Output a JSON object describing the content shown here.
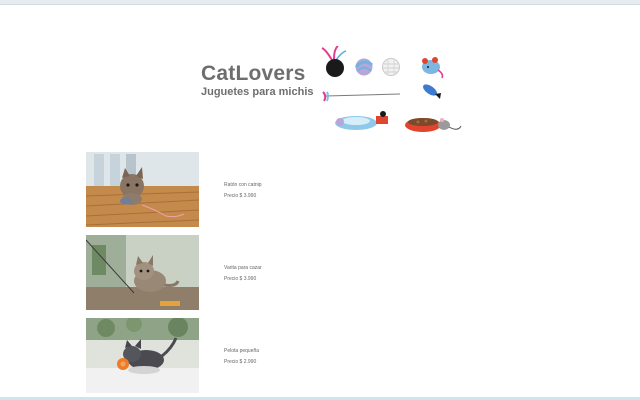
{
  "header": {
    "title": "CatLovers",
    "subtitle": "Juguetes para michis"
  },
  "hero_toys": {
    "icons": [
      "feather-ball-toy-icon",
      "yarn-ball-toy-icon",
      "knit-ball-toy-icon",
      "toy-mouse-icon",
      "feather-wand-icon",
      "fish-toy-icon",
      "ball-track-toy-icon",
      "food-bowl-mouse-icon"
    ],
    "colors": {
      "black": "#1a1a1a",
      "pink": "#e23c8e",
      "blue": "#6fb4e0",
      "lavender": "#b9a6d8",
      "red": "#e2452f",
      "white": "#f2f2f2"
    }
  },
  "products": [
    {
      "name": "Ratón con catnip",
      "price": "Precio $ 3.990",
      "photo": "kitten-with-mouse-toy"
    },
    {
      "name": "Varita para cazar",
      "price": "Precio $ 3.990",
      "photo": "kitten-with-wand-toy"
    },
    {
      "name": "Pelota pequeña",
      "price": "Precio $ 2.990",
      "photo": "kitten-with-small-ball"
    }
  ]
}
